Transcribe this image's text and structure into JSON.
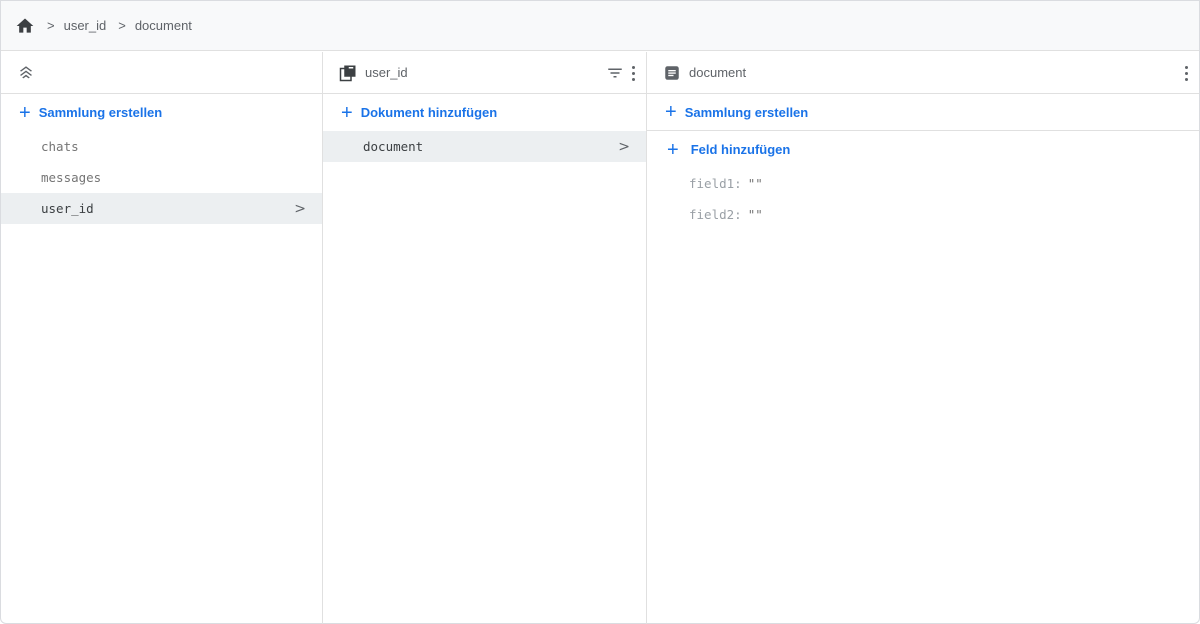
{
  "breadcrumb": {
    "home_icon": "home-icon",
    "items": [
      "user_id",
      "document"
    ],
    "separator": ">"
  },
  "root_column": {
    "header_icon": "firestore-stack-icon",
    "add_label": "Sammlung erstellen",
    "collections": [
      "chats",
      "messages",
      "user_id"
    ],
    "selected": "user_id"
  },
  "collection_column": {
    "header_icon": "collection-icon",
    "title": "user_id",
    "add_label": "Dokument hinzufügen",
    "documents": [
      "document"
    ],
    "selected": "document"
  },
  "document_column": {
    "header_icon": "document-icon",
    "title": "document",
    "add_collection_label": "Sammlung erstellen",
    "add_field_label": "Feld hinzufügen",
    "fields": [
      {
        "key": "field1:",
        "value": "\"\""
      },
      {
        "key": "field2:",
        "value": "\"\""
      }
    ]
  },
  "colors": {
    "accent": "#1a73e8",
    "selected_bg": "#eceff1"
  }
}
